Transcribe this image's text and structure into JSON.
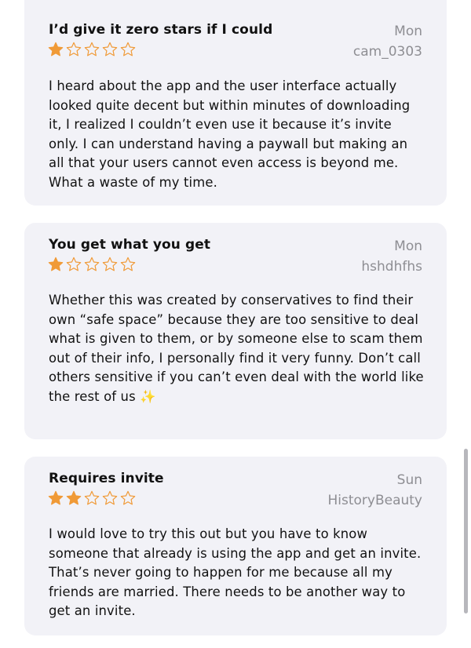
{
  "reviews": [
    {
      "title": "I’d give it zero stars if I could",
      "date": "Mon",
      "author": "cam_0303",
      "rating": 1,
      "max_rating": 5,
      "body": "I heard about the app and the user interface actually looked quite decent but within minutes of downloading it, I realized I couldn’t even use it because it’s invite only. I can understand having a paywall but making an all that your users cannot even access is beyond me. What a waste of my time."
    },
    {
      "title": "You get what you get",
      "date": "Mon",
      "author": "hshdhfhs",
      "rating": 1,
      "max_rating": 5,
      "body": "Whether this was created by conservatives to find their own “safe space” because they are too sensitive to deal what is given to them, or by someone else to scam them out of their info, I personally find it very funny. Don’t call others sensitive if you can’t even deal with the world like the rest of us ✨"
    },
    {
      "title": "Requires invite",
      "date": "Sun",
      "author": "HistoryBeauty",
      "rating": 2,
      "max_rating": 5,
      "body": "I would love to try this out but you have to know someone that already is using the app and get an invite. That’s never going to happen for me because all my friends are married. There needs to be another way to get an invite."
    }
  ],
  "colors": {
    "star": "#f09a37",
    "card_bg": "#f2f2f7",
    "muted_text": "#8e8e93",
    "text": "#111111"
  },
  "icons": {
    "star_filled": "star-filled-icon",
    "star_empty": "star-outline-icon"
  }
}
